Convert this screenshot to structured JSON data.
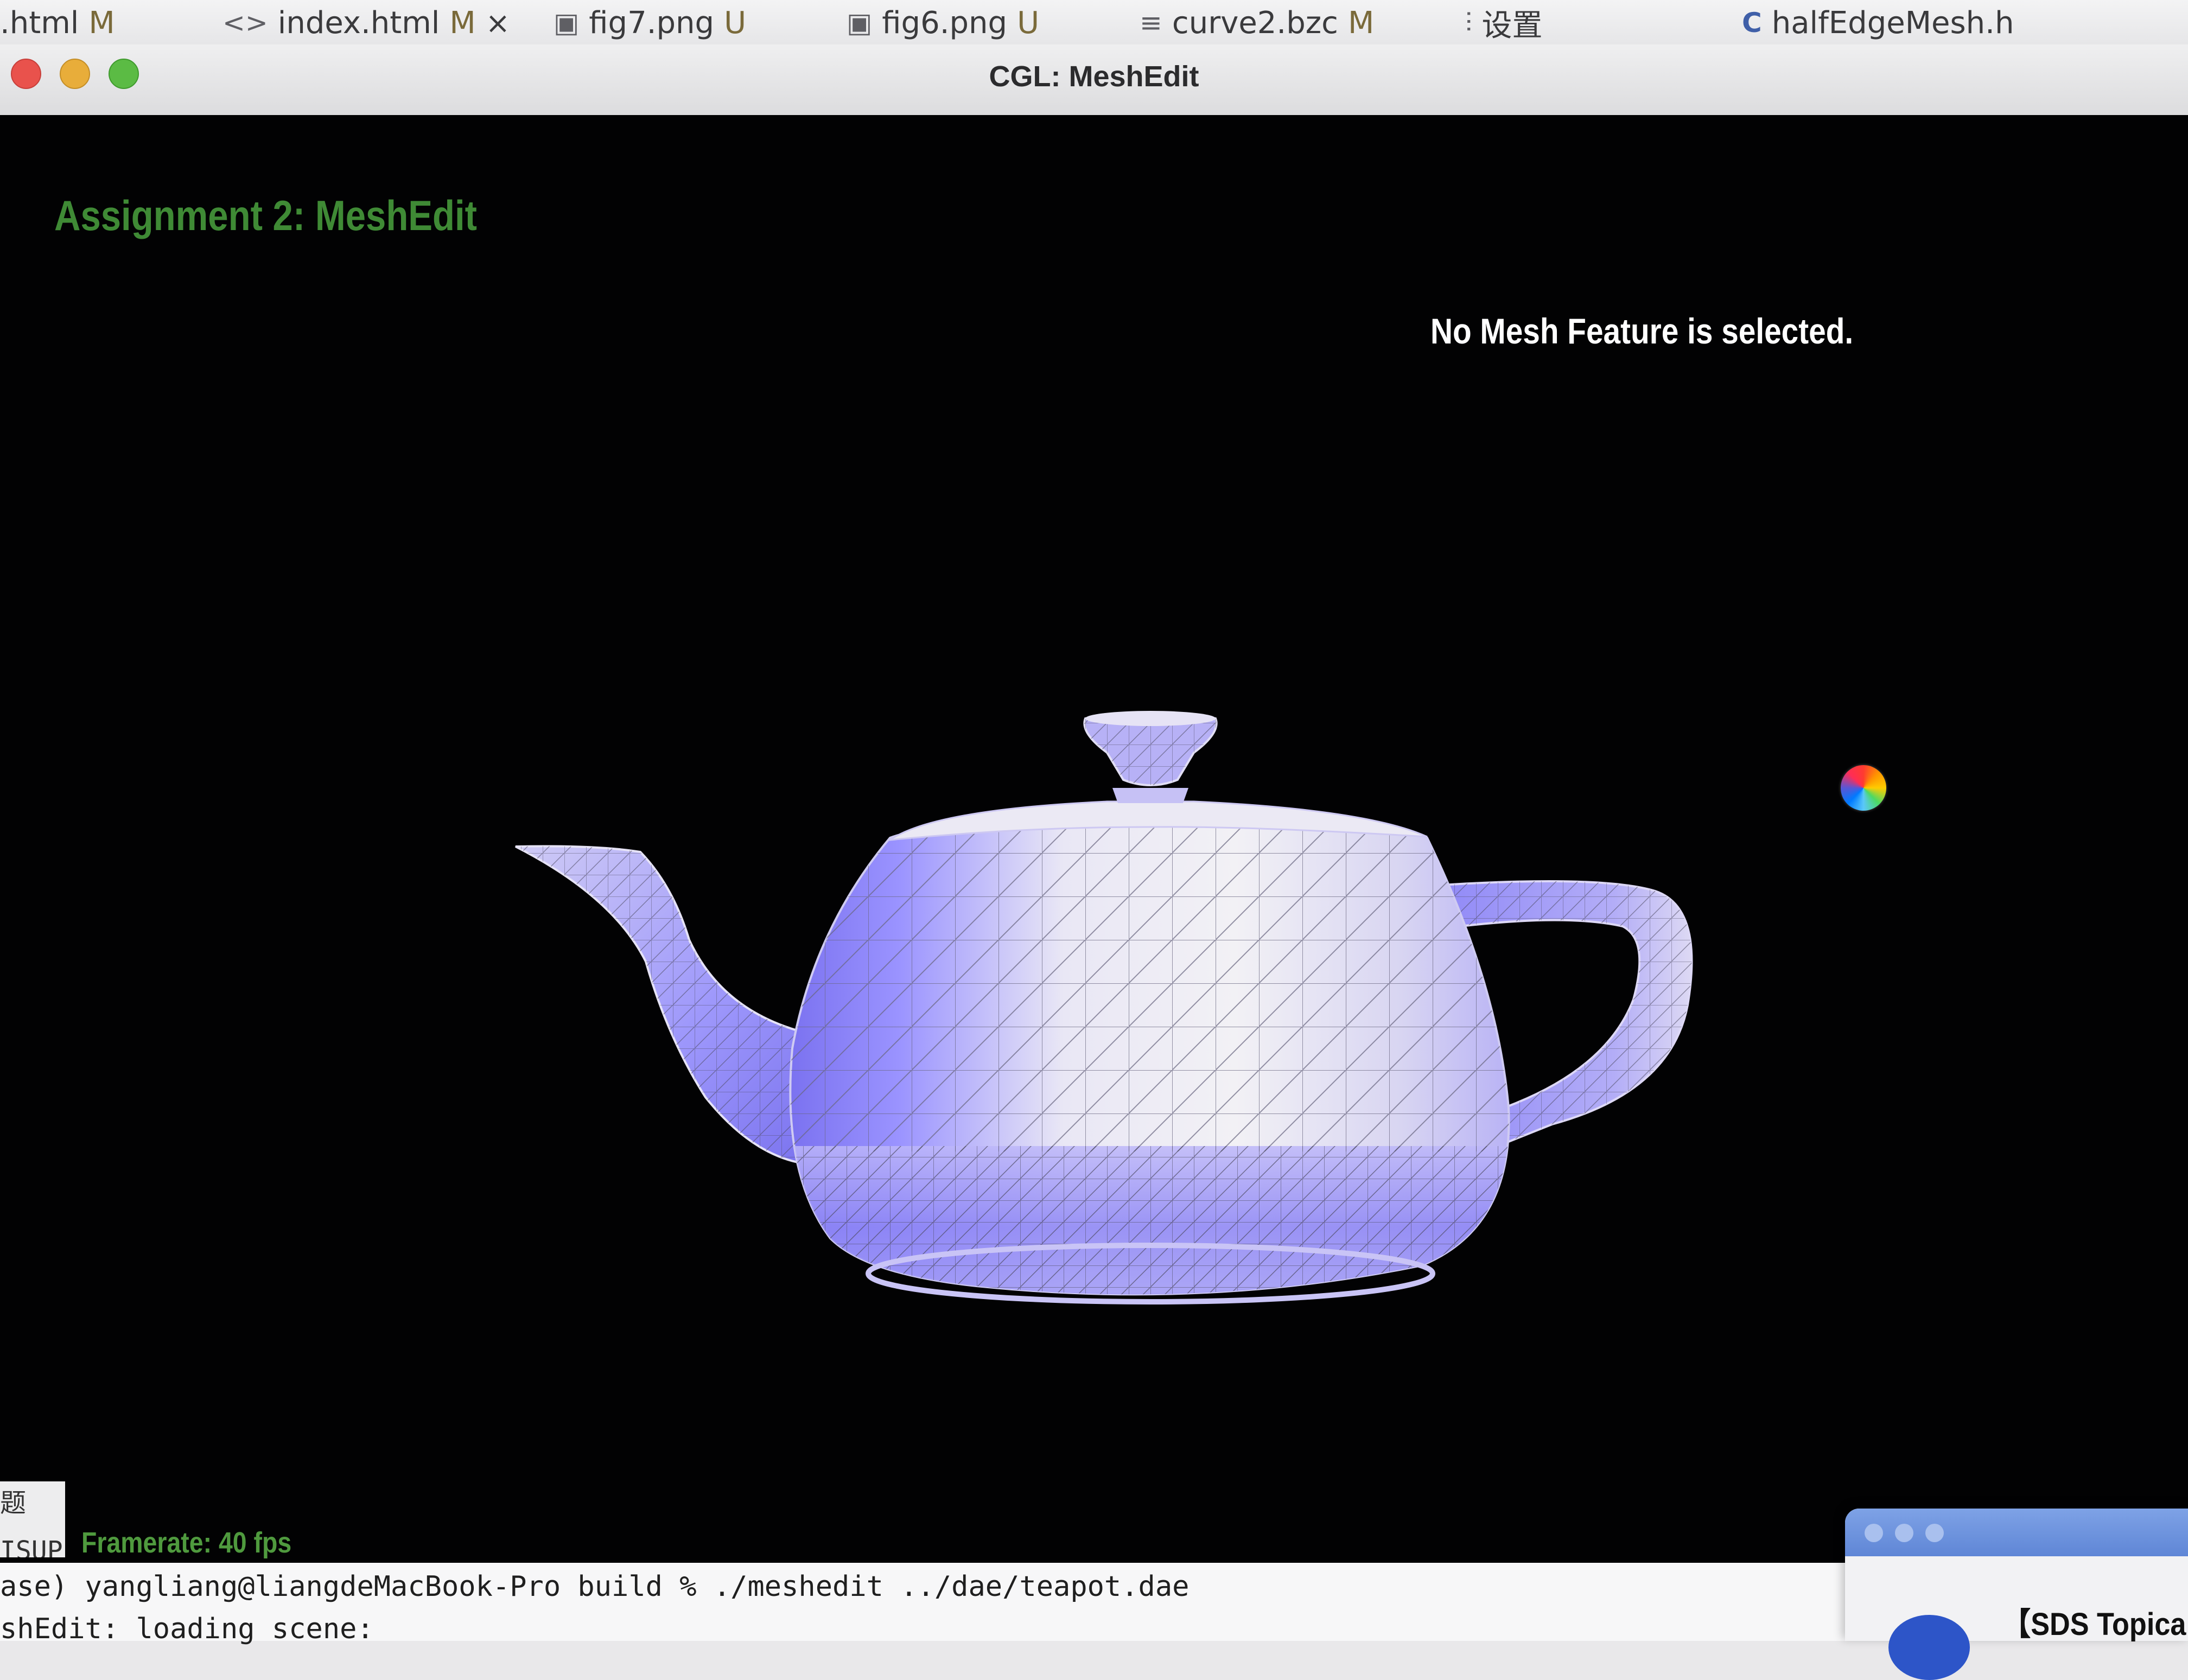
{
  "editor_tabs": [
    {
      "icon": "",
      "label": ".html",
      "status": "M"
    },
    {
      "icon": "<>",
      "label": "index.html",
      "status": "M",
      "close": "×"
    },
    {
      "icon": "▣",
      "label": "fig7.png",
      "status": "U"
    },
    {
      "icon": "▣",
      "label": "fig6.png",
      "status": "U"
    },
    {
      "icon": "≡",
      "label": "curve2.bzc",
      "status": "M"
    },
    {
      "icon": "⫶",
      "label": "设置",
      "status": ""
    },
    {
      "icon": "C",
      "label": "halfEdgeMesh.h",
      "status": ""
    }
  ],
  "window": {
    "title": "CGL: MeshEdit"
  },
  "viewport": {
    "assignment_title": "Assignment 2: MeshEdit",
    "selection_status": "No Mesh Feature is selected.",
    "framerate": "Framerate: 40 fps",
    "mesh_color": "#8d86ff",
    "title_color": "#3f8a35"
  },
  "terminal": {
    "command_line": "ase) yangliang@liangdeMacBook-Pro build % ./meshedit ../dae/teapot.dae",
    "output_line": "shEdit: loading scene:",
    "left_fragment_1": "题",
    "left_fragment_2": "ISUPI"
  },
  "notification": {
    "title": "【SDS Topical"
  }
}
